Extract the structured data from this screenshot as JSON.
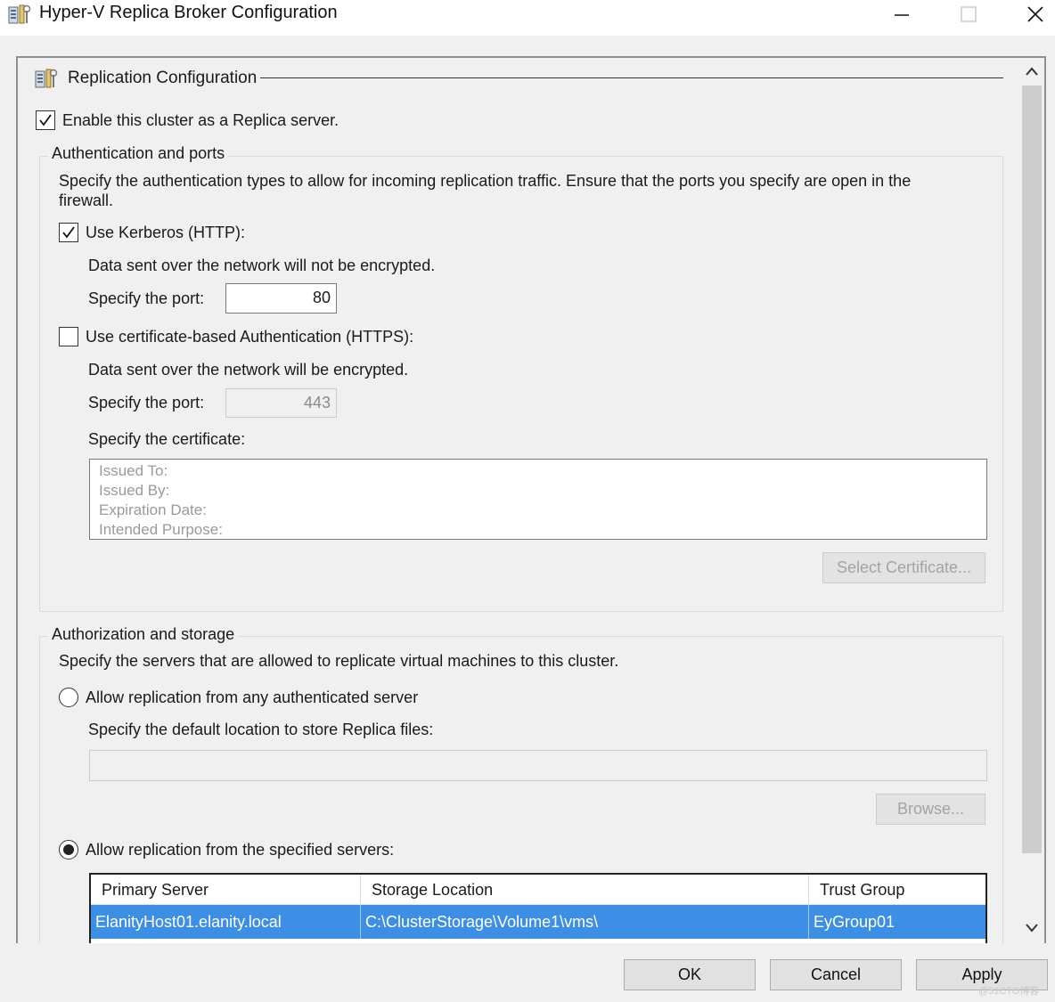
{
  "window": {
    "title": "Hyper-V Replica Broker Configuration",
    "app_icon": "server-config-icon"
  },
  "section": {
    "title": "Replication Configuration",
    "icon": "server-config-icon"
  },
  "enable_replica": {
    "label": "Enable this cluster as a Replica server.",
    "checked": true
  },
  "auth_group": {
    "legend": "Authentication and ports",
    "description": "Specify the authentication types to allow for incoming replication traffic. Ensure that the ports you specify are open in the firewall.",
    "kerberos": {
      "label": "Use Kerberos (HTTP):",
      "checked": true,
      "note": "Data sent over the network will not be encrypted.",
      "port_label": "Specify the port:",
      "port": "80"
    },
    "certificate": {
      "label": "Use certificate-based Authentication (HTTPS):",
      "checked": false,
      "note": "Data sent over the network will be encrypted.",
      "port_label": "Specify the port:",
      "port": "443",
      "cert_label": "Specify the certificate:",
      "issued_to": "Issued To:",
      "issued_by": "Issued By:",
      "expiration": "Expiration Date:",
      "purpose": "Intended Purpose:",
      "select_button": "Select Certificate..."
    }
  },
  "authz_group": {
    "legend": "Authorization and storage",
    "description": "Specify the servers that are allowed to replicate virtual machines to this cluster.",
    "any_server": {
      "label": "Allow replication from any authenticated server",
      "selected": false,
      "location_label": "Specify the default location to store Replica files:",
      "location_value": "",
      "browse_button": "Browse..."
    },
    "specified_servers": {
      "label": "Allow replication from the specified servers:",
      "selected": true,
      "columns": [
        "Primary Server",
        "Storage Location",
        "Trust Group"
      ],
      "rows": [
        [
          "ElanityHost01.elanity.local",
          "C:\\ClusterStorage\\Volume1\\vms\\",
          "EyGroup01"
        ]
      ]
    }
  },
  "buttons": {
    "ok": "OK",
    "cancel": "Cancel",
    "apply": "Apply"
  },
  "watermark": "@51CTO博客",
  "colors": {
    "selection": "#3d8fe5",
    "panel_bg": "#f0f0f0"
  }
}
